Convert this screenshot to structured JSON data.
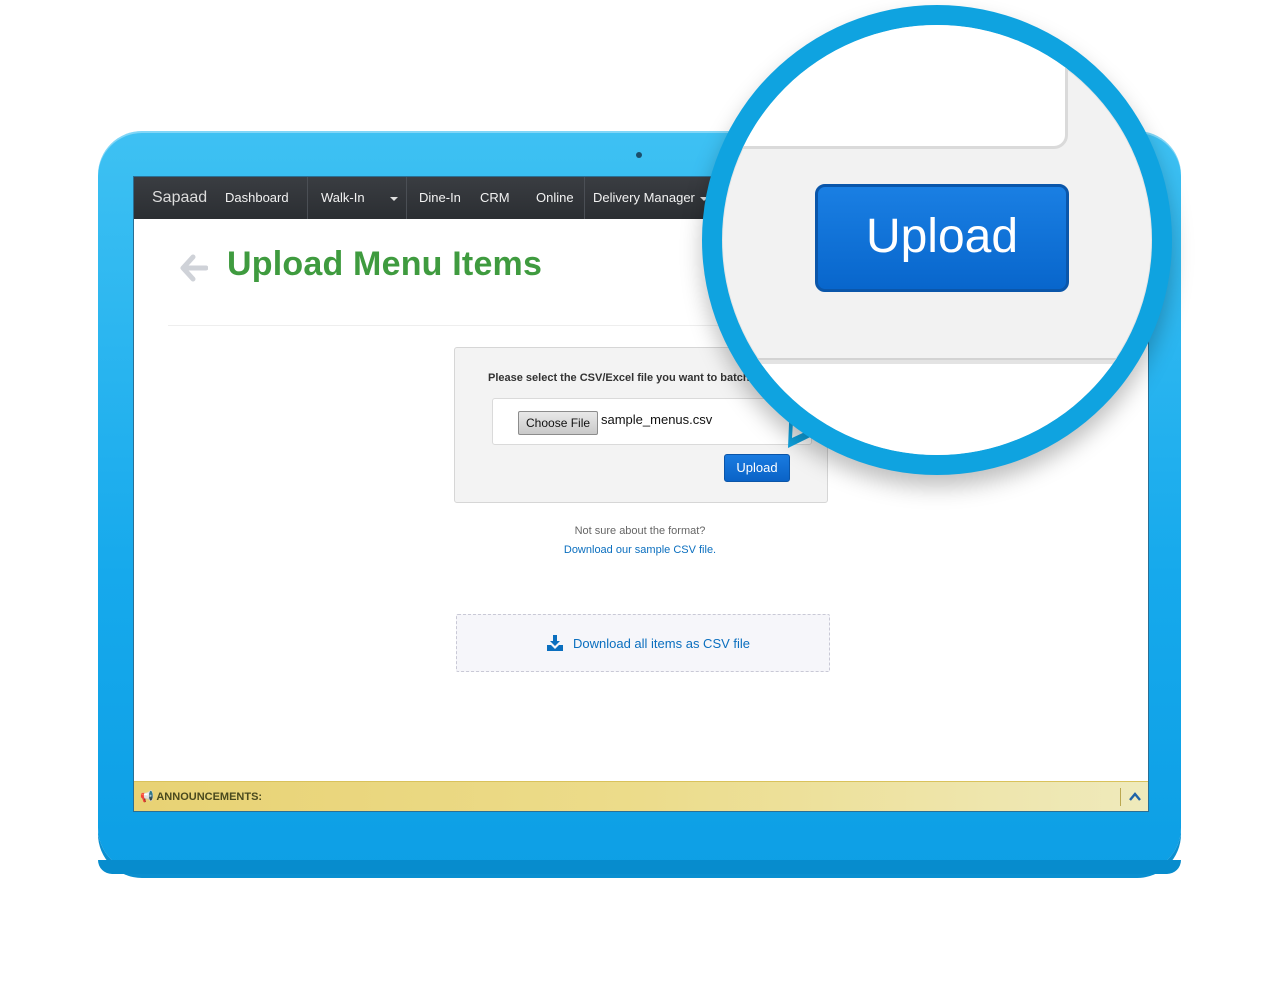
{
  "navbar": {
    "brand": "Sapaad",
    "items": [
      {
        "label": "Dashboard"
      },
      {
        "label": "Walk-In"
      },
      {
        "label": "Dine-In"
      },
      {
        "label": "CRM"
      },
      {
        "label": "Online"
      },
      {
        "label": "Delivery Manager"
      }
    ]
  },
  "page": {
    "title": "Upload Menu Items"
  },
  "upload_panel": {
    "prompt": "Please select the CSV/Excel file you want to batch",
    "choose_file_label": "Choose File",
    "file_name": "sample_menus.csv",
    "upload_label": "Upload"
  },
  "help": {
    "question": "Not sure about the format?",
    "link": "Download our sample CSV file."
  },
  "download_all": {
    "label": "Download all items as CSV file"
  },
  "announcements": {
    "label": "ANNOUNCEMENTS:"
  },
  "zoom": {
    "upload_label": "Upload"
  },
  "colors": {
    "device": "#16a9ec",
    "title_green": "#3f9b3f",
    "button_blue": "#0a63c7",
    "link_blue": "#0b6fbf",
    "navbar": "#2b2e32"
  }
}
